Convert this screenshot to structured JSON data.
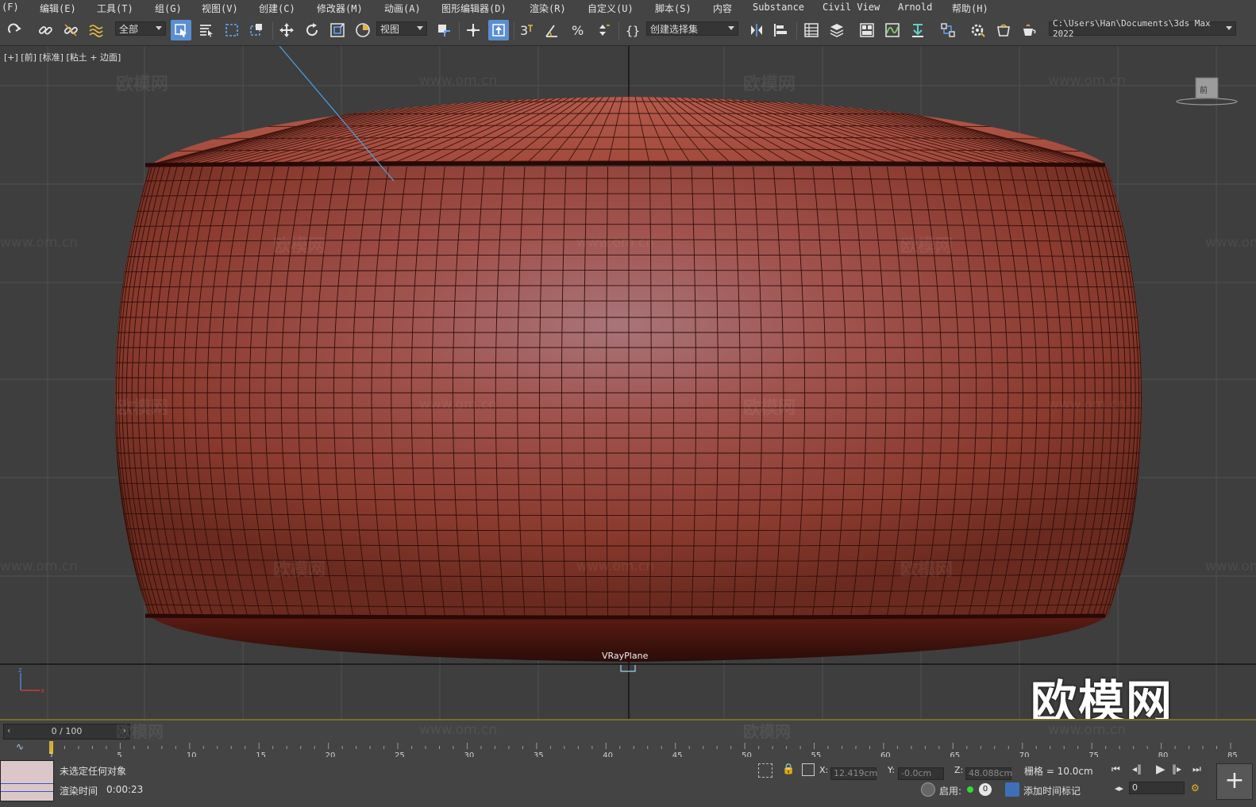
{
  "menu": {
    "items": [
      "(F)",
      "编辑(E)",
      "工具(T)",
      "组(G)",
      "视图(V)",
      "创建(C)",
      "修改器(M)",
      "动画(A)",
      "图形编辑器(D)",
      "渲染(R)",
      "自定义(U)",
      "脚本(S)",
      "内容",
      "Substance",
      "Civil View",
      "Arnold",
      "帮助(H)"
    ]
  },
  "toolbar": {
    "selection_filter": "全部",
    "ref_coord": "视图",
    "named_selection": "创建选择集",
    "project_path": "C:\\Users\\Han\\Documents\\3ds Max 2022"
  },
  "viewport": {
    "label": "[+] [前] [标准] [粘土 + 边面]",
    "object_label": "VRayPlane",
    "viewcube_label": "前",
    "watermark_brand": "欧模网",
    "watermark_url": "www.om.cn",
    "mesh_color": "#b3473a"
  },
  "timeline": {
    "slider_text": "0 / 100",
    "ticks": [
      "0",
      "5",
      "10",
      "15",
      "20",
      "25",
      "30",
      "35",
      "40",
      "45",
      "50",
      "55",
      "60",
      "65",
      "70",
      "75",
      "80",
      "85"
    ]
  },
  "status": {
    "selection": "未选定任何对象",
    "render_time_label": "渲染时间",
    "render_time": "0:00:23",
    "x_label": "X:",
    "x_value": "12.419cm",
    "y_label": "Y:",
    "y_value": "-0.0cm",
    "z_label": "Z:",
    "z_value": "48.088cm",
    "grid": "栅格 = 10.0cm",
    "enable_label": "启用:",
    "enable_value": "0",
    "add_time_tag": "添加时间标记",
    "frame_field": "0"
  },
  "branding": {
    "logo_text": "欧模网"
  }
}
